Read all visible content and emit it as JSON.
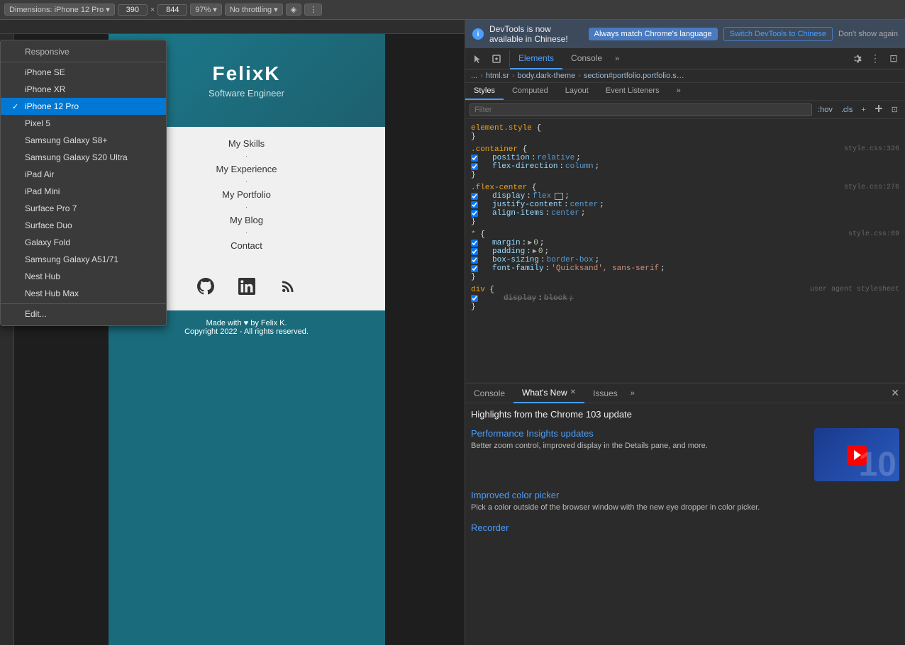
{
  "toolbar": {
    "dimensions_label": "Dimensions: iPhone 12 Pro",
    "width_value": "390",
    "height_value": "844",
    "zoom_value": "97%",
    "throttle_value": "No throttling",
    "dropdown_arrow": "▾"
  },
  "device_menu": {
    "items": [
      {
        "id": "responsive",
        "label": "Responsive",
        "selected": false
      },
      {
        "id": "iphone-se",
        "label": "iPhone SE",
        "selected": false
      },
      {
        "id": "iphone-xr",
        "label": "iPhone XR",
        "selected": false
      },
      {
        "id": "iphone-12-pro",
        "label": "iPhone 12 Pro",
        "selected": true
      },
      {
        "id": "pixel-5",
        "label": "Pixel 5",
        "selected": false
      },
      {
        "id": "samsung-s8",
        "label": "Samsung Galaxy S8+",
        "selected": false
      },
      {
        "id": "samsung-s20",
        "label": "Samsung Galaxy S20 Ultra",
        "selected": false
      },
      {
        "id": "ipad-air",
        "label": "iPad Air",
        "selected": false
      },
      {
        "id": "ipad-mini",
        "label": "iPad Mini",
        "selected": false
      },
      {
        "id": "surface-pro-7",
        "label": "Surface Pro 7",
        "selected": false
      },
      {
        "id": "surface-duo",
        "label": "Surface Duo",
        "selected": false
      },
      {
        "id": "galaxy-fold",
        "label": "Galaxy Fold",
        "selected": false
      },
      {
        "id": "samsung-a51",
        "label": "Samsung Galaxy A51/71",
        "selected": false
      },
      {
        "id": "nest-hub",
        "label": "Nest Hub",
        "selected": false
      },
      {
        "id": "nest-hub-max",
        "label": "Nest Hub Max",
        "selected": false
      },
      {
        "id": "edit",
        "label": "Edit...",
        "selected": false
      }
    ]
  },
  "website": {
    "name": "FelixK",
    "subtitle": "ware Engineer",
    "nav_items": [
      "My Skills",
      "My Experience",
      "My Portfolio",
      "My Blog",
      "Contact"
    ],
    "footer_copyright": "Made with ♥ by Felix K.",
    "footer_rights": "Copyright 2022 - All rights reserved."
  },
  "devtools": {
    "notification": {
      "icon": "i",
      "message": "DevTools is now available in Chinese!",
      "btn1": "Always match Chrome's language",
      "btn2": "Switch DevTools to Chinese",
      "dismiss": "Don't show again"
    },
    "tabs": [
      "Elements",
      "Console",
      "»"
    ],
    "active_tab": "Elements",
    "breadcrumb": [
      "...",
      "html.sr",
      "body.dark-theme",
      "section#portfolio.portfolio.s…"
    ],
    "styles": {
      "filter_placeholder": "Filter",
      "hov_label": ":hov",
      "cls_label": ".cls",
      "rules": [
        {
          "selector": "element.style",
          "source": "",
          "properties": [
            {
              "prop": "",
              "value": "{",
              "is_brace": true
            },
            {
              "prop": "",
              "value": "}",
              "is_brace_close": true
            }
          ]
        },
        {
          "selector": ".container",
          "source": "style.css:326",
          "properties": [
            {
              "prop": "position",
              "value": "relative",
              "type": "keyword"
            },
            {
              "prop": "flex-direction",
              "value": "column",
              "type": "keyword"
            }
          ]
        },
        {
          "selector": ".flex-center",
          "source": "style.css:276",
          "properties": [
            {
              "prop": "display",
              "value": "flex",
              "type": "keyword",
              "has_icon": true
            },
            {
              "prop": "justify-content",
              "value": "center",
              "type": "keyword"
            },
            {
              "prop": "align-items",
              "value": "center",
              "type": "keyword"
            }
          ]
        },
        {
          "selector": "*",
          "source": "style.css:69",
          "properties": [
            {
              "prop": "margin",
              "value": "▶ 0",
              "type": "number"
            },
            {
              "prop": "padding",
              "value": "▶ 0",
              "type": "number"
            },
            {
              "prop": "box-sizing",
              "value": "border-box",
              "type": "keyword"
            },
            {
              "prop": "font-family",
              "value": "'Quicksand', sans-serif",
              "type": "string"
            }
          ]
        },
        {
          "selector": "div",
          "source": "user agent stylesheet",
          "properties": [
            {
              "prop": "display",
              "value": "block",
              "type": "keyword",
              "strikethrough": true
            }
          ]
        }
      ]
    },
    "bottom_tabs": [
      "Console",
      "What's New",
      "Issues"
    ],
    "active_bottom_tab": "What's New",
    "whats_new": {
      "title": "Highlights from the Chrome 103 update",
      "features": [
        {
          "id": "perf-insights",
          "title": "Performance Insights updates",
          "desc": "Better zoom control, improved display in the Details pane, and more.",
          "has_thumb": true
        },
        {
          "id": "color-picker",
          "title": "Improved color picker",
          "desc": "Pick a color outside of the browser window with the new eye dropper in color picker.",
          "has_thumb": false
        },
        {
          "id": "recorder",
          "title": "Recorder",
          "desc": "",
          "has_thumb": false
        }
      ]
    }
  }
}
